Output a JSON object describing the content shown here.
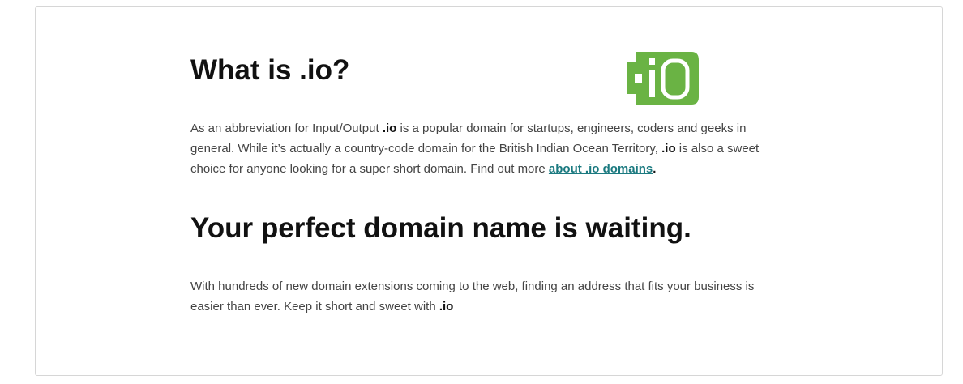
{
  "section1": {
    "title": "What is .io?",
    "text_before": "As an abbreviation for Input/Output ",
    "bold1": ".io",
    "text_mid": " is a popular domain for startups, engineers, coders and geeks in general. While it’s actually a country-code domain for the British Indian Ocean Territory, ",
    "bold2": ".io",
    "text_after": " is also a sweet choice for anyone looking for a super short domain. Find out more ",
    "link": "about .io domains",
    "end": "."
  },
  "logo": {
    "text": ".io",
    "color": "#6ab344"
  },
  "section2": {
    "title": "Your perfect domain name is waiting.",
    "text": "With hundreds of new domain extensions coming to the web, finding an address that fits your business is easier than ever. Keep it short and sweet with ",
    "bold": ".io"
  }
}
